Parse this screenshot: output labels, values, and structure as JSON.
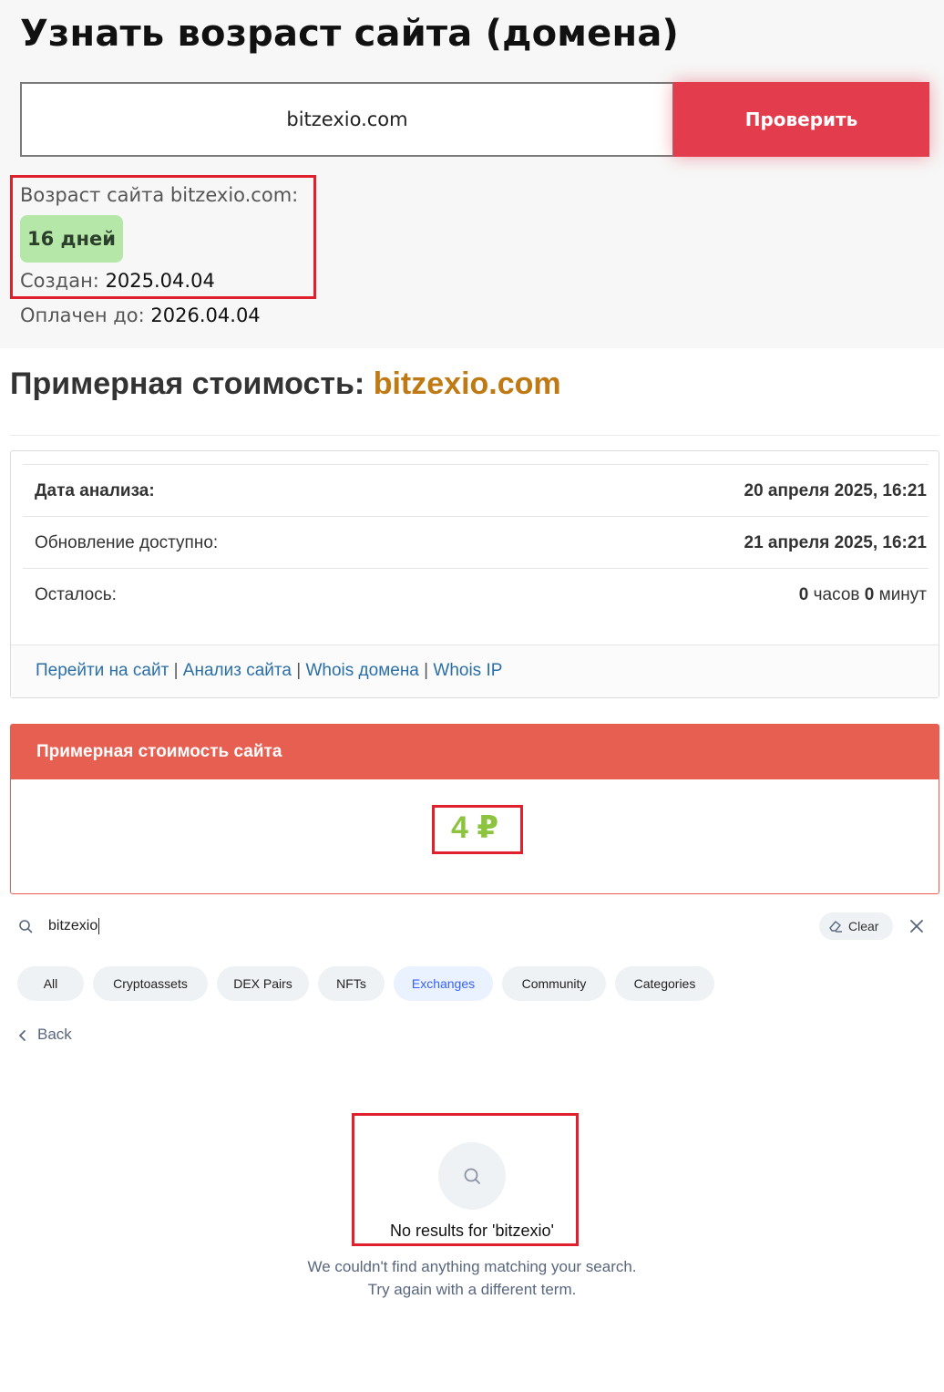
{
  "age_check": {
    "title": "Узнать возраст сайта (домена)",
    "input_value": "bitzexio.com",
    "check_button": "Проверить",
    "age_label": "Возраст сайта bitzexio.com:",
    "age_value": "16 дней",
    "created_label": "Создан:",
    "created_value": "2025.04.04",
    "paid_label": "Оплачен до:",
    "paid_value": "2026.04.04"
  },
  "cost": {
    "title_prefix": "Примерная стоимость:",
    "title_domain": "bitzexio.com",
    "domain_color": "#c07a14",
    "rows": [
      {
        "label": "Дата анализа:",
        "value": "20 апреля 2025, 16:21"
      },
      {
        "label": "Обновление доступно:",
        "value": "21 апреля 2025, 16:21"
      },
      {
        "label": "Осталось:",
        "value_hours": "0",
        "value_hours_unit": "часов",
        "value_minutes": "0",
        "value_minutes_unit": "минут"
      }
    ],
    "links": [
      "Перейти на сайт",
      "Анализ сайта",
      "Whois домена",
      "Whois IP"
    ],
    "link_separator": "|",
    "price_header": "Примерная стоимость сайта",
    "price_value": "4 ₽",
    "header_color": "#e65f50",
    "price_color": "#8cc43f"
  },
  "search": {
    "query": "bitzexio",
    "clear_label": "Clear",
    "chips": [
      "All",
      "Cryptoassets",
      "DEX Pairs",
      "NFTs",
      "Exchanges",
      "Community",
      "Categories"
    ],
    "active_chip": "Exchanges",
    "back_label": "Back",
    "empty_title": "No results for 'bitzexio'",
    "empty_line1": "We couldn't find anything matching your search.",
    "empty_line2": "Try again with a different term.",
    "accent_color": "#3861fb"
  }
}
